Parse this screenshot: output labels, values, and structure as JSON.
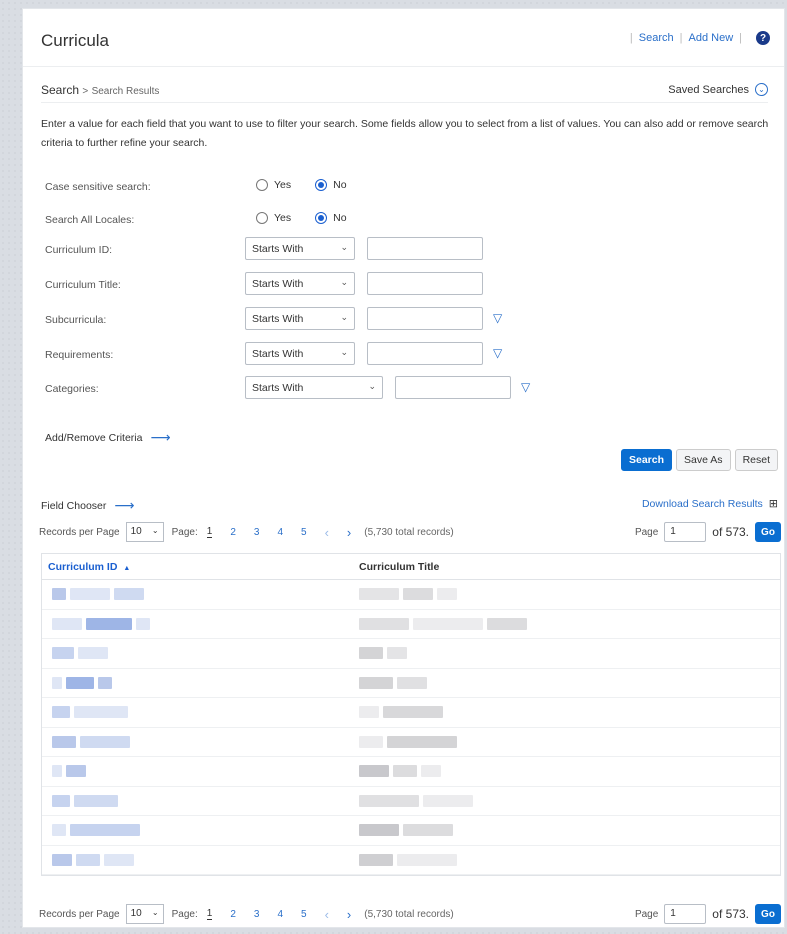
{
  "header": {
    "title": "Curricula",
    "search_link": "Search",
    "add_new_link": "Add New",
    "help_icon": "?"
  },
  "breadcrumb": {
    "root": "Search",
    "separator": ">",
    "current": "Search Results",
    "saved_searches": "Saved Searches"
  },
  "intro_text": "Enter a value for each field that you want to use to filter your search. Some fields allow you to select from a list of values. You can also add or remove search criteria to further refine your search.",
  "criteria": {
    "case_sensitive": {
      "label": "Case sensitive search:",
      "yes": "Yes",
      "no": "No",
      "selected": "No"
    },
    "search_all_locales": {
      "label": "Search All Locales:",
      "yes": "Yes",
      "no": "No",
      "selected": "No"
    },
    "curriculum_id": {
      "label": "Curriculum ID:",
      "operator": "Starts With",
      "value": ""
    },
    "curriculum_title": {
      "label": "Curriculum Title:",
      "operator": "Starts With",
      "value": ""
    },
    "subcurricula": {
      "label": "Subcurricula:",
      "operator": "Starts With",
      "value": ""
    },
    "requirements": {
      "label": "Requirements:",
      "operator": "Starts With",
      "value": ""
    },
    "categories": {
      "label": "Categories:",
      "operator": "Starts With",
      "value": ""
    },
    "add_remove": "Add/Remove Criteria"
  },
  "buttons": {
    "search": "Search",
    "save_as": "Save As",
    "reset": "Reset"
  },
  "results": {
    "field_chooser": "Field Chooser",
    "download": "Download Search Results",
    "pager": {
      "records_per_page_label": "Records per Page",
      "records_per_page": "10",
      "page_label": "Page:",
      "pages": [
        "1",
        "2",
        "3",
        "4",
        "5"
      ],
      "current_page": "1",
      "total_records": "(5,730 total records)",
      "page_input_label": "Page",
      "page_input_value": "1",
      "of_pages": "of 573.",
      "go": "Go"
    },
    "columns": {
      "id": "Curriculum ID",
      "sort_indicator": "▲",
      "title": "Curriculum Title"
    },
    "row_count": 10
  },
  "colors": {
    "accent": "#0a6ed1",
    "link": "#2a6fc9",
    "help_icon_bg": "#1a3a8a"
  }
}
